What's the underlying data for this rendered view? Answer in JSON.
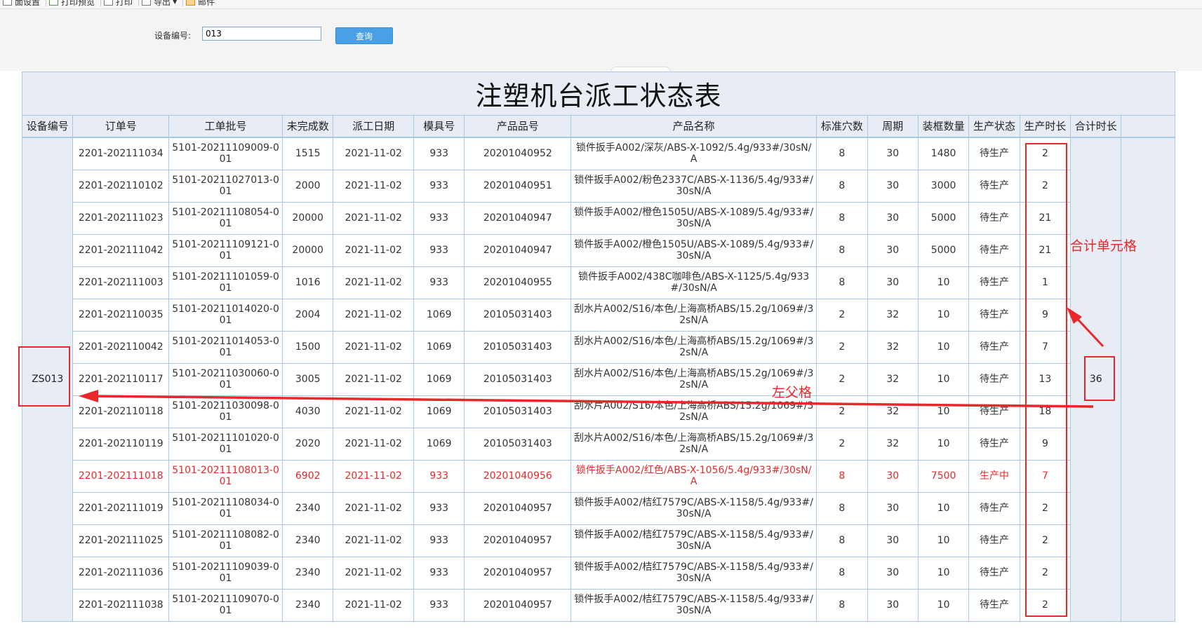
{
  "toolbar": {
    "items": [
      {
        "label": "面设置",
        "icon": "page-setup-icon"
      },
      {
        "label": "打印预览",
        "icon": "print-preview-icon"
      },
      {
        "label": "打印",
        "icon": "printer-icon"
      },
      {
        "label": "导出",
        "icon": "export-icon"
      },
      {
        "label": "邮件",
        "icon": "mail-icon"
      }
    ]
  },
  "query": {
    "label": "设备编号:",
    "value": "013",
    "button": "查询"
  },
  "report": {
    "title": "注塑机台派工状态表",
    "headers": [
      "设备编号",
      "订单号",
      "工单批号",
      "未完成数",
      "派工日期",
      "模具号",
      "产品品号",
      "产品名称",
      "标准穴数",
      "周期",
      "装框数量",
      "生产状态",
      "生产时长",
      "合计时长"
    ],
    "device": "ZS013",
    "total": "36",
    "rows": [
      {
        "order": "2201-202111034",
        "batch": "5101-20211109009-001",
        "pending": "1515",
        "date": "2021-11-02",
        "mold": "933",
        "code": "20201040952",
        "name": "锁件扳手A002/深灰/ABS-X-1092/5.4g/933#/30sN/A",
        "cavities": "8",
        "cycle": "30",
        "qty": "1480",
        "status": "待生产",
        "hours": "2"
      },
      {
        "order": "2201-202110102",
        "batch": "5101-20211027013-001",
        "pending": "2000",
        "date": "2021-11-02",
        "mold": "933",
        "code": "20201040951",
        "name": "锁件扳手A002/粉色2337C/ABS-X-1136/5.4g/933#/30sN/A",
        "cavities": "8",
        "cycle": "30",
        "qty": "3000",
        "status": "待生产",
        "hours": "2"
      },
      {
        "order": "2201-202111023",
        "batch": "5101-20211108054-001",
        "pending": "20000",
        "date": "2021-11-02",
        "mold": "933",
        "code": "20201040947",
        "name": "锁件扳手A002/橙色1505U/ABS-X-1089/5.4g/933#/30sN/A",
        "cavities": "8",
        "cycle": "30",
        "qty": "5000",
        "status": "待生产",
        "hours": "21"
      },
      {
        "order": "2201-202111042",
        "batch": "5101-20211109121-001",
        "pending": "20000",
        "date": "2021-11-02",
        "mold": "933",
        "code": "20201040947",
        "name": "锁件扳手A002/橙色1505U/ABS-X-1089/5.4g/933#/30sN/A",
        "cavities": "8",
        "cycle": "30",
        "qty": "5000",
        "status": "待生产",
        "hours": "21"
      },
      {
        "order": "2201-202111003",
        "batch": "5101-20211101059-001",
        "pending": "1016",
        "date": "2021-11-02",
        "mold": "933",
        "code": "20201040955",
        "name": "锁件扳手A002/438C咖啡色/ABS-X-1125/5.4g/933#/30sN/A",
        "cavities": "8",
        "cycle": "30",
        "qty": "10",
        "status": "待生产",
        "hours": "1"
      },
      {
        "order": "2201-202110035",
        "batch": "5101-20211014020-001",
        "pending": "2004",
        "date": "2021-11-02",
        "mold": "1069",
        "code": "20105031403",
        "name": "刮水片A002/S16/本色/上海高桥ABS/15.2g/1069#/32sN/A",
        "cavities": "2",
        "cycle": "32",
        "qty": "10",
        "status": "待生产",
        "hours": "9"
      },
      {
        "order": "2201-202110042",
        "batch": "5101-20211014053-001",
        "pending": "1500",
        "date": "2021-11-02",
        "mold": "1069",
        "code": "20105031403",
        "name": "刮水片A002/S16/本色/上海高桥ABS/15.2g/1069#/32sN/A",
        "cavities": "2",
        "cycle": "32",
        "qty": "10",
        "status": "待生产",
        "hours": "7"
      },
      {
        "order": "2201-202110117",
        "batch": "5101-20211030060-001",
        "pending": "3005",
        "date": "2021-11-02",
        "mold": "1069",
        "code": "20105031403",
        "name": "刮水片A002/S16/本色/上海高桥ABS/15.2g/1069#/32sN/A",
        "cavities": "2",
        "cycle": "32",
        "qty": "10",
        "status": "待生产",
        "hours": "13"
      },
      {
        "order": "2201-202110118",
        "batch": "5101-20211030098-001",
        "pending": "4030",
        "date": "2021-11-02",
        "mold": "1069",
        "code": "20105031403",
        "name": "刮水片A002/S16/本色/上海高桥ABS/15.2g/1069#/32sN/A",
        "cavities": "2",
        "cycle": "32",
        "qty": "10",
        "status": "待生产",
        "hours": "18"
      },
      {
        "order": "2201-202110119",
        "batch": "5101-20211101020-001",
        "pending": "2020",
        "date": "2021-11-02",
        "mold": "1069",
        "code": "20105031403",
        "name": "刮水片A002/S16/本色/上海高桥ABS/15.2g/1069#/32sN/A",
        "cavities": "2",
        "cycle": "32",
        "qty": "10",
        "status": "待生产",
        "hours": "9"
      },
      {
        "order": "2201-202111018",
        "batch": "5101-20211108013-001",
        "pending": "6902",
        "date": "2021-11-02",
        "mold": "933",
        "code": "20201040956",
        "name": "锁件扳手A002/红色/ABS-X-1056/5.4g/933#/30sN/A",
        "cavities": "8",
        "cycle": "30",
        "qty": "7500",
        "status": "生产中",
        "hours": "7",
        "active": true
      },
      {
        "order": "2201-202111019",
        "batch": "5101-20211108034-001",
        "pending": "2340",
        "date": "2021-11-02",
        "mold": "933",
        "code": "20201040957",
        "name": "锁件扳手A002/桔红7579C/ABS-X-1158/5.4g/933#/30sN/A",
        "cavities": "8",
        "cycle": "30",
        "qty": "10",
        "status": "待生产",
        "hours": "2"
      },
      {
        "order": "2201-202111025",
        "batch": "5101-20211108082-001",
        "pending": "2340",
        "date": "2021-11-02",
        "mold": "933",
        "code": "20201040957",
        "name": "锁件扳手A002/桔红7579C/ABS-X-1158/5.4g/933#/30sN/A",
        "cavities": "8",
        "cycle": "30",
        "qty": "10",
        "status": "待生产",
        "hours": "2"
      },
      {
        "order": "2201-202111036",
        "batch": "5101-20211109039-001",
        "pending": "2340",
        "date": "2021-11-02",
        "mold": "933",
        "code": "20201040957",
        "name": "锁件扳手A002/桔红7579C/ABS-X-1158/5.4g/933#/30sN/A",
        "cavities": "8",
        "cycle": "30",
        "qty": "10",
        "status": "待生产",
        "hours": "2"
      },
      {
        "order": "2201-202111038",
        "batch": "5101-20211109070-001",
        "pending": "2340",
        "date": "2021-11-02",
        "mold": "933",
        "code": "20201040957",
        "name": "锁件扳手A002/桔红7579C/ABS-X-1158/5.4g/933#/30sN/A",
        "cavities": "8",
        "cycle": "30",
        "qty": "10",
        "status": "待生产",
        "hours": "2"
      }
    ]
  },
  "annotations": {
    "sum_cell": "合计单元格",
    "left_parent": "左父格"
  },
  "colors": {
    "header_bg": "#e8ecf4",
    "grid_border": "#a9c8e6",
    "active_text": "#e8282a",
    "annotation": "#e8282a",
    "query_button": "#4aa0e6"
  }
}
